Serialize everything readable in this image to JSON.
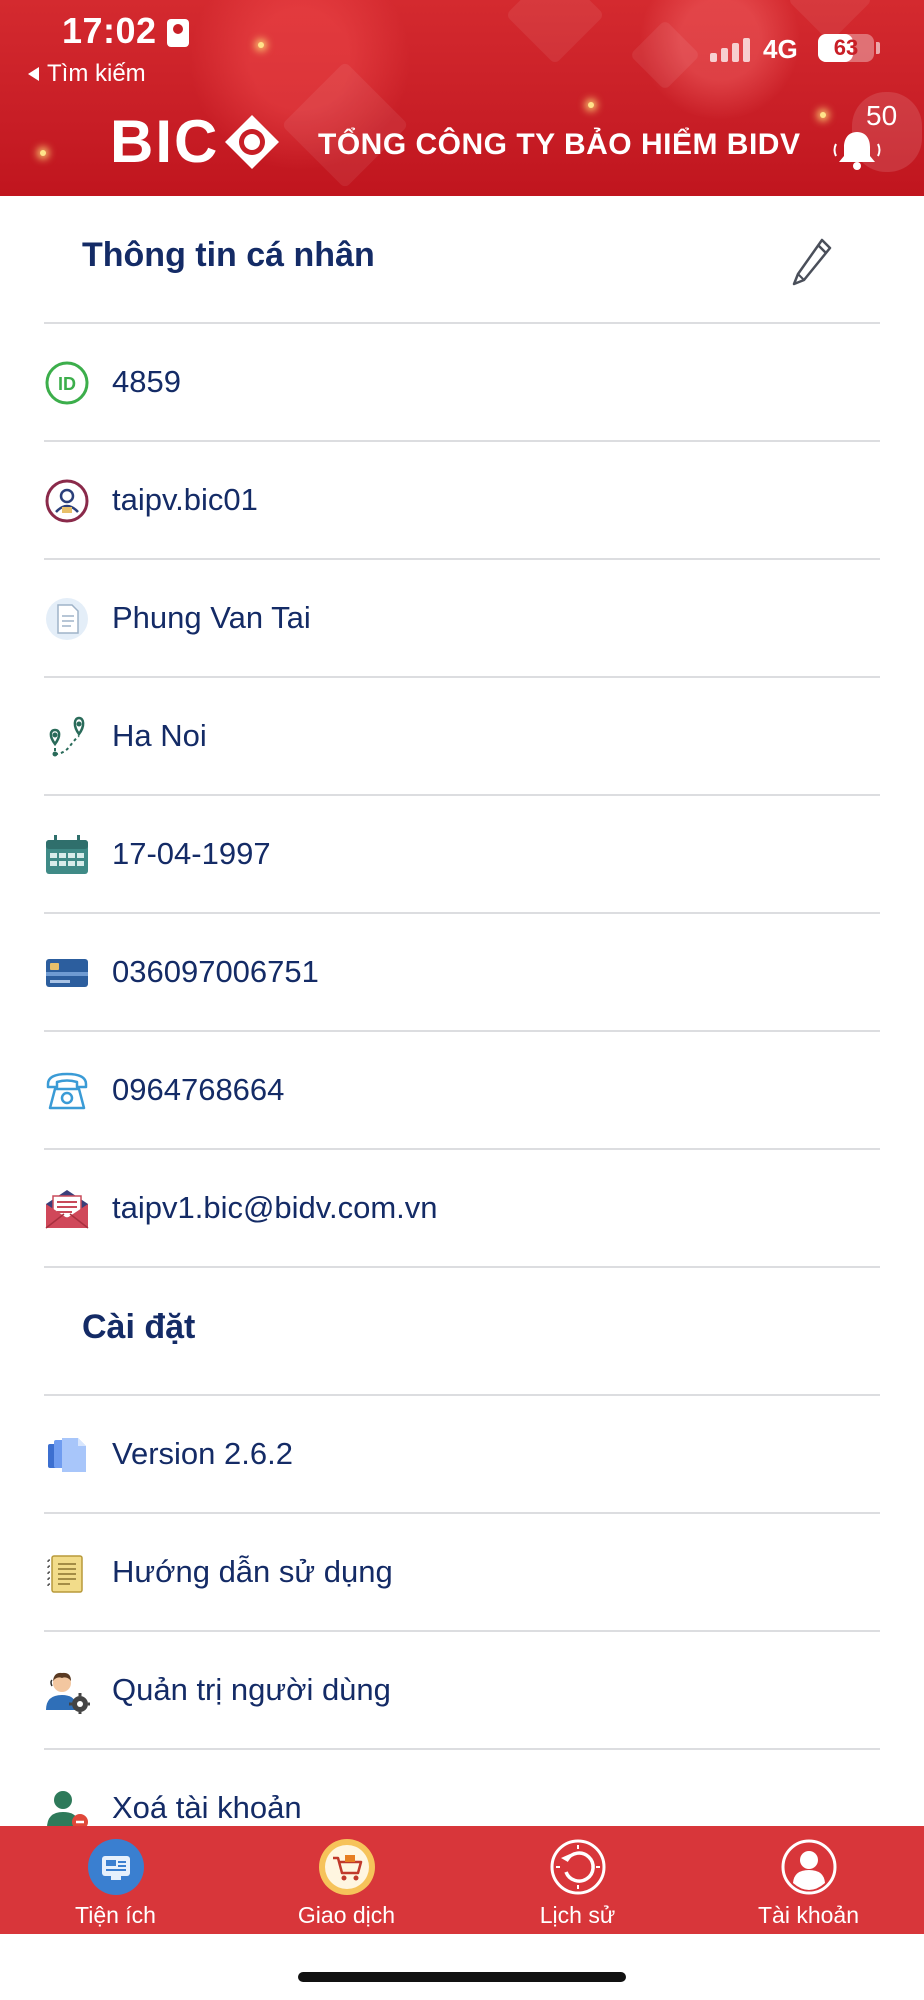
{
  "status_bar": {
    "time": "17:02",
    "network": "4G",
    "battery": "63",
    "battery_level": 0.63,
    "back_label": "Tìm kiếm"
  },
  "header": {
    "logo_text": "BIC",
    "company_name": "TỔNG CÔNG TY BẢO HIỂM BIDV",
    "notification_count": "50",
    "brand_color": "#c81e26"
  },
  "personal": {
    "title": "Thông tin cá nhân",
    "items": [
      {
        "icon": "id-icon",
        "value": "4859"
      },
      {
        "icon": "user-badge-icon",
        "value": "taipv.bic01"
      },
      {
        "icon": "document-icon",
        "value": "Phung Van Tai"
      },
      {
        "icon": "location-route-icon",
        "value": "Ha Noi"
      },
      {
        "icon": "calendar-icon",
        "value": "17-04-1997"
      },
      {
        "icon": "id-card-icon",
        "value": "036097006751"
      },
      {
        "icon": "telephone-icon",
        "value": "0964768664"
      },
      {
        "icon": "mail-icon",
        "value": "taipv1.bic@bidv.com.vn"
      }
    ]
  },
  "settings": {
    "title": "Cài đặt",
    "items": [
      {
        "icon": "version-icon",
        "label": "Version 2.6.2"
      },
      {
        "icon": "guide-icon",
        "label": "Hướng dẫn sử dụng"
      },
      {
        "icon": "admin-user-icon",
        "label": "Quản trị người dùng"
      },
      {
        "icon": "delete-account-icon",
        "label": "Xoá tài khoản"
      }
    ]
  },
  "bottom_nav": [
    {
      "icon": "utilities-icon",
      "label": "Tiện ích"
    },
    {
      "icon": "cart-icon",
      "label": "Giao dịch"
    },
    {
      "icon": "history-icon",
      "label": "Lịch sử"
    },
    {
      "icon": "account-icon",
      "label": "Tài khoản"
    }
  ]
}
